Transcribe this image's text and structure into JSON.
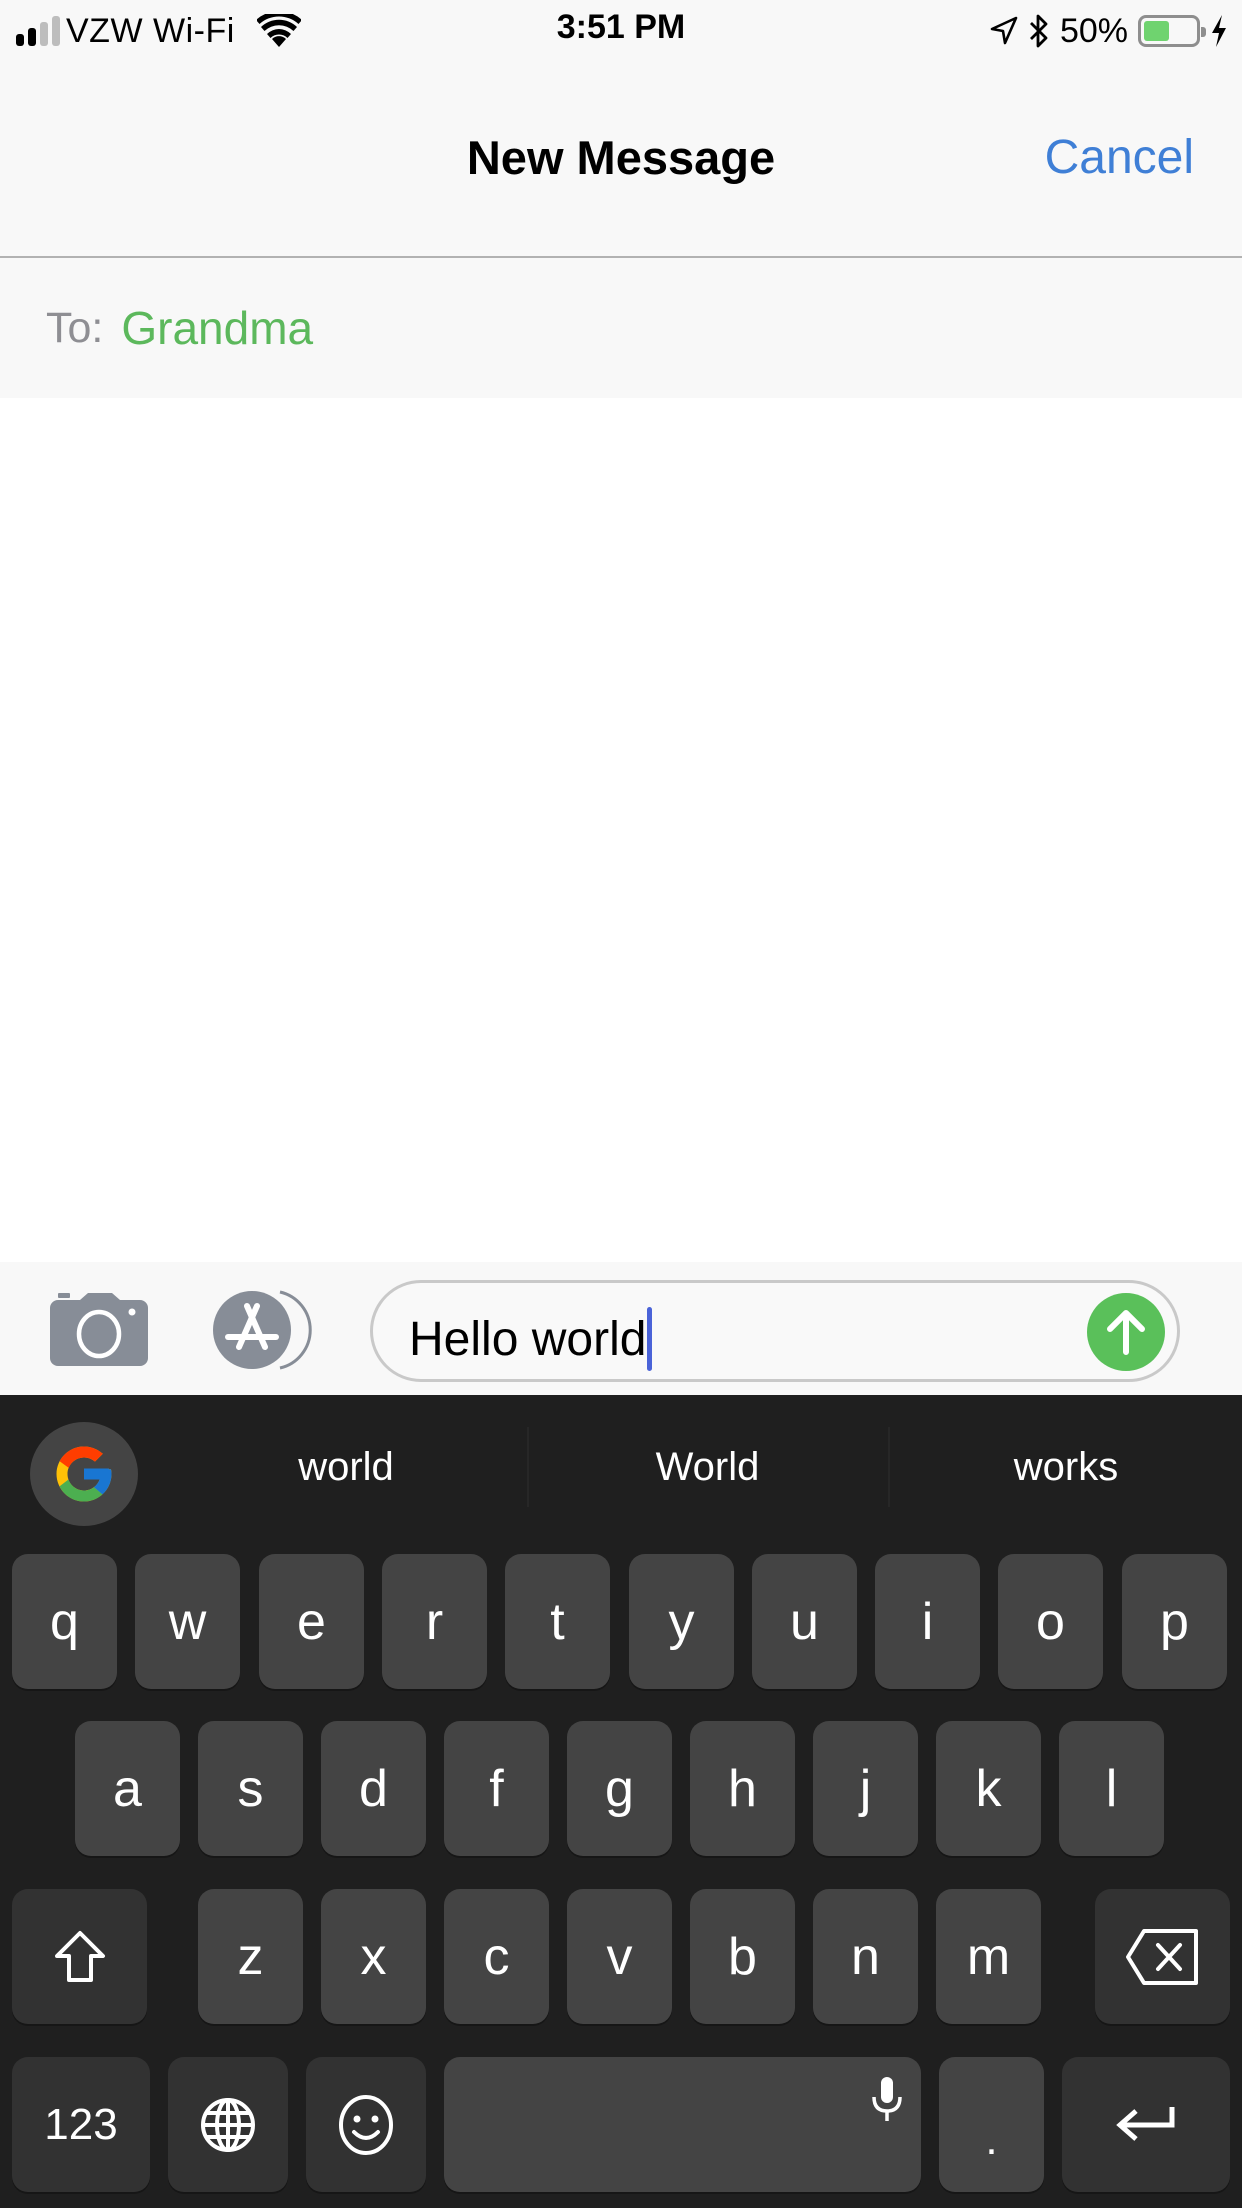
{
  "status_bar": {
    "signal_bars_filled": 2,
    "signal_bars_total": 4,
    "carrier": "VZW Wi-Fi",
    "wifi_icon": "wifi-icon",
    "time": "3:51 PM",
    "location_icon": "location-arrow-icon",
    "bluetooth_icon": "bluetooth-icon",
    "battery_percent_label": "50%",
    "battery_level": 0.5,
    "charging_icon": "bolt-icon"
  },
  "nav": {
    "title": "New Message",
    "cancel_label": "Cancel"
  },
  "to_field": {
    "label": "To:",
    "recipient": "Grandma"
  },
  "compose": {
    "camera_icon": "camera-icon",
    "apps_icon": "app-store-icon",
    "message_text": "Hello world",
    "send_icon": "arrow-up-icon"
  },
  "keyboard": {
    "google_icon": "google-g-icon",
    "suggestions": [
      "world",
      "World",
      "works"
    ],
    "row1": [
      "q",
      "w",
      "e",
      "r",
      "t",
      "y",
      "u",
      "i",
      "o",
      "p"
    ],
    "row2": [
      "a",
      "s",
      "d",
      "f",
      "g",
      "h",
      "j",
      "k",
      "l"
    ],
    "row3": [
      "z",
      "x",
      "c",
      "v",
      "b",
      "n",
      "m"
    ],
    "shift_icon": "shift-icon",
    "backspace_icon": "backspace-icon",
    "numbers_label": "123",
    "globe_icon": "globe-icon",
    "emoji_icon": "emoji-icon",
    "mic_icon": "microphone-icon",
    "period_label": ".",
    "return_icon": "return-icon"
  },
  "colors": {
    "accent_blue": "#3f7fd6",
    "imessage_green": "#5ac05a",
    "recipient_green": "#5cb85c",
    "caret_blue": "#4a63d8",
    "battery_green": "#6fd36f",
    "keyboard_bg": "#1f1f1f",
    "key_bg": "#444444",
    "func_key_bg": "#323232"
  }
}
